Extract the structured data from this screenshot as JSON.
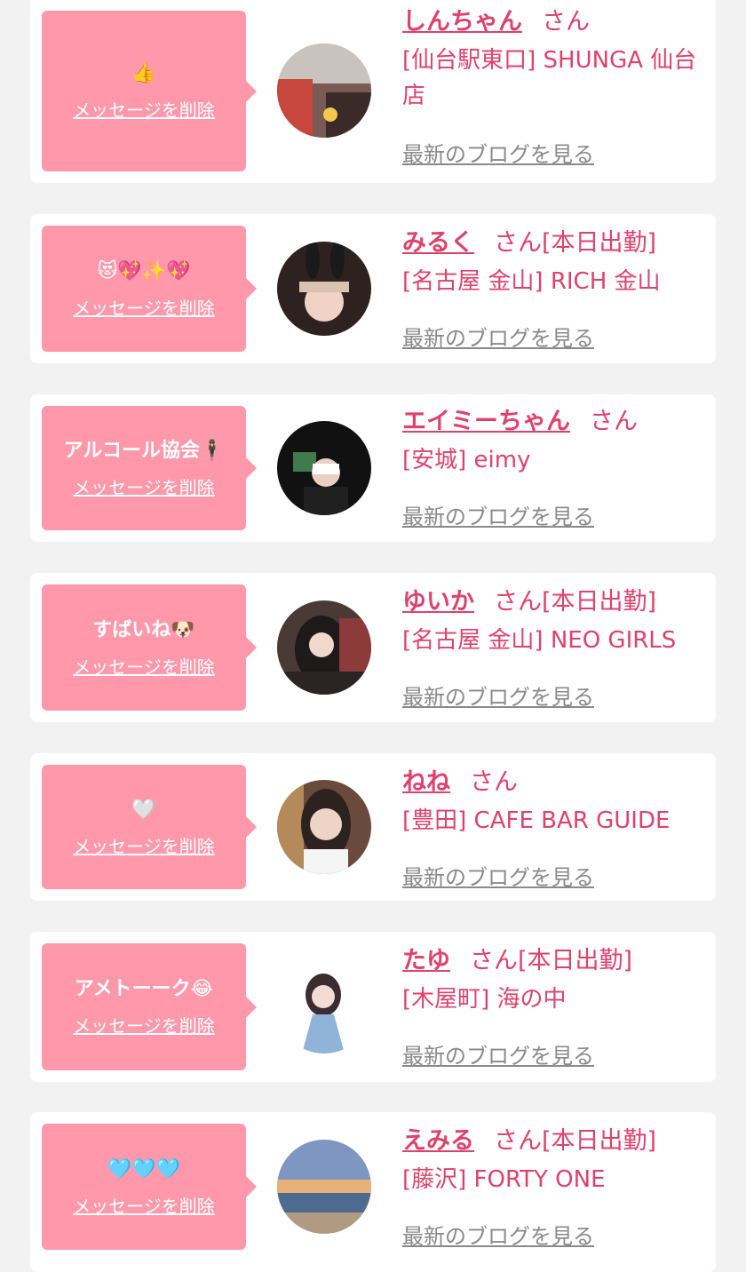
{
  "colors": {
    "background": "#f2f2f2",
    "card": "#ffffff",
    "bubble": "#ff98aa",
    "accent": "#e0416c",
    "link_gray": "#8a8a8a"
  },
  "delete_label": "メッセージを削除",
  "san_label": "さん",
  "working_today_label": "[本日出勤]",
  "blog_label": "最新のブログを見る",
  "items": [
    {
      "message": "👍",
      "name": "しんちゃん",
      "working_today": false,
      "shop": "[仙台駅東口] SHUNGA 仙台店"
    },
    {
      "message": "😻💖✨💖",
      "name": "みるく",
      "working_today": true,
      "shop": "[名古屋 金山] RICH 金山"
    },
    {
      "message": "アルコール協会🕴",
      "name": "エイミーちゃん",
      "working_today": false,
      "shop": "[安城] eimy"
    },
    {
      "message": "すばいね🐶",
      "name": "ゆいか",
      "working_today": true,
      "shop": "[名古屋 金山] NEO GIRLS"
    },
    {
      "message": "🤍",
      "name": "ねね",
      "working_today": false,
      "shop": "[豊田] CAFE BAR GUIDE"
    },
    {
      "message": "アメトーーク😂",
      "name": "たゆ",
      "working_today": true,
      "shop": "[木屋町] 海の中"
    },
    {
      "message": "🩵🩵🩵",
      "name": "えみる",
      "working_today": true,
      "shop": "[藤沢] FORTY ONE"
    }
  ]
}
